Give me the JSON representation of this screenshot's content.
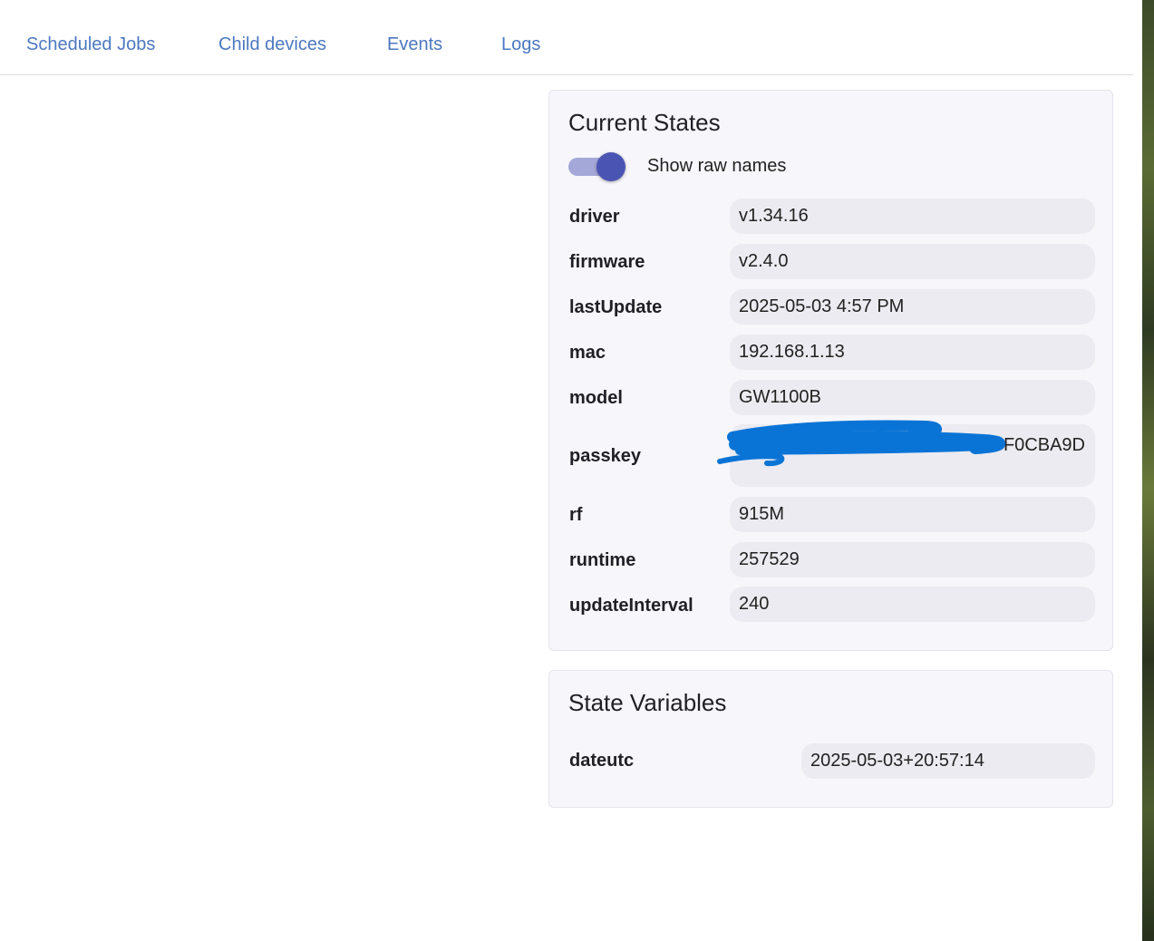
{
  "tabs": [
    {
      "label": "Scheduled Jobs"
    },
    {
      "label": "Child devices"
    },
    {
      "label": "Events"
    },
    {
      "label": "Logs"
    }
  ],
  "current_states": {
    "title": "Current States",
    "toggle_label": "Show raw names",
    "toggle_on": true,
    "rows": [
      {
        "label": "driver",
        "value": "v1.34.16"
      },
      {
        "label": "firmware",
        "value": "v2.4.0"
      },
      {
        "label": "lastUpdate",
        "value": "2025-05-03 4:57 PM"
      },
      {
        "label": "mac",
        "value": "192.168.1.13"
      },
      {
        "label": "model",
        "value": "GW1100B"
      },
      {
        "label": "passkey",
        "value": "ACBDF0CBA9D"
      },
      {
        "label": "rf",
        "value": "915M"
      },
      {
        "label": "runtime",
        "value": "257529"
      },
      {
        "label": "updateInterval",
        "value": "240"
      }
    ]
  },
  "state_variables": {
    "title": "State Variables",
    "rows": [
      {
        "label": "dateutc",
        "value": "2025-05-03+20:57:14"
      }
    ]
  },
  "colors": {
    "tab_link": "#4c78c0",
    "toggle_knob": "#4a55b3",
    "toggle_track": "#a4a8d8",
    "card_background": "#f6f6fb",
    "value_pill": "#ebebf1",
    "redaction": "#0a74d6"
  }
}
